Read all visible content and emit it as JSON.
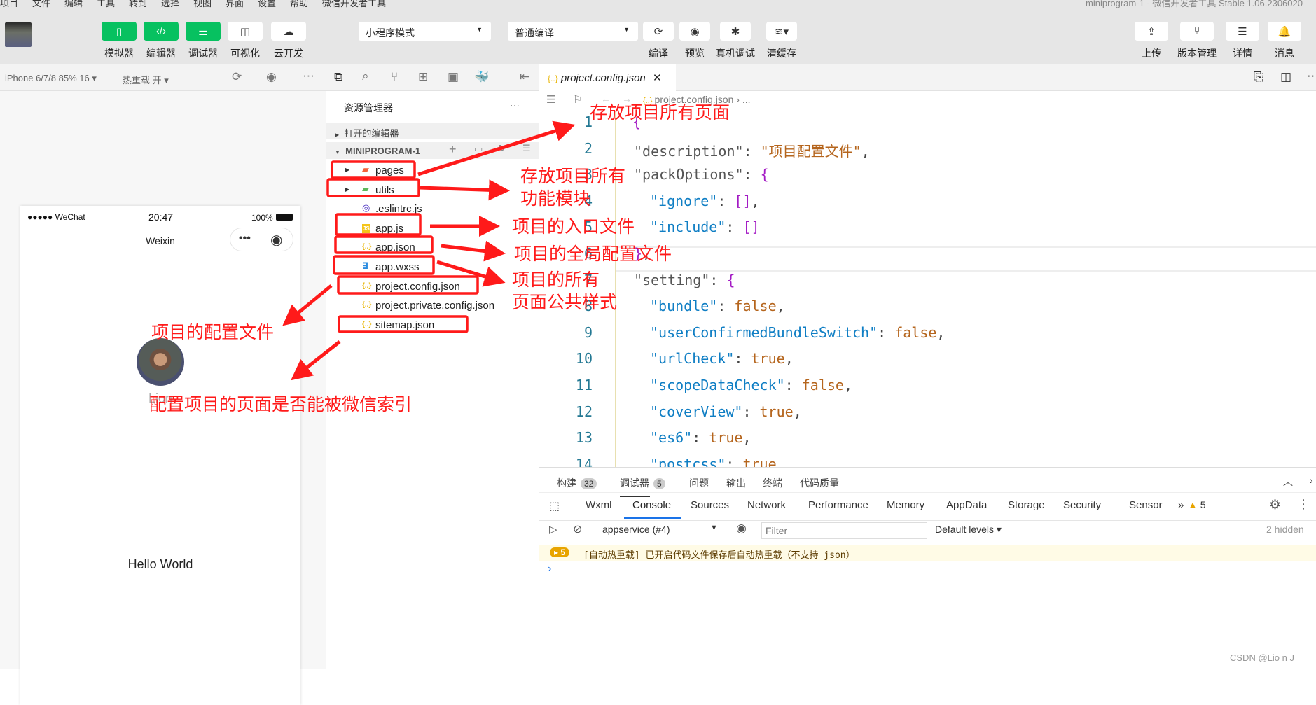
{
  "menubar": {
    "items": [
      "项目",
      "文件",
      "编辑",
      "工具",
      "转到",
      "选择",
      "视图",
      "界面",
      "设置",
      "帮助",
      "微信开发者工具"
    ],
    "title": "miniprogram-1 - 微信开发者工具 Stable 1.06.2306020"
  },
  "toolbar": {
    "left_buttons": [
      {
        "label": "模拟器",
        "icon": "phone-icon"
      },
      {
        "label": "编辑器",
        "icon": "code-icon"
      },
      {
        "label": "调试器",
        "icon": "sliders-icon"
      },
      {
        "label": "可视化",
        "icon": "layout-icon"
      },
      {
        "label": "云开发",
        "icon": "cloud-icon"
      }
    ],
    "mode_select": "小程序模式",
    "compile_select": "普通编译",
    "mid_buttons": [
      {
        "label": "编译",
        "icon": "refresh-icon"
      },
      {
        "label": "预览",
        "icon": "eye-icon"
      },
      {
        "label": "真机调试",
        "icon": "bug-icon"
      },
      {
        "label": "清缓存",
        "icon": "layers-icon"
      }
    ],
    "right_buttons": [
      {
        "label": "上传",
        "icon": "upload-icon"
      },
      {
        "label": "版本管理",
        "icon": "branch-icon"
      },
      {
        "label": "详情",
        "icon": "menu-icon"
      },
      {
        "label": "消息",
        "icon": "bell-icon"
      }
    ]
  },
  "simbar": {
    "device": "iPhone 6/7/8 85% 16 ▾",
    "hot_reload": "热重载 开 ▾"
  },
  "phone": {
    "carrier": "●●●●● WeChat",
    "time": "20:47",
    "battery": "100%",
    "nav_title": "Weixin",
    "username": "Lion",
    "hello": "Hello World"
  },
  "explorer": {
    "title": "资源管理器",
    "more": "···",
    "open_editors": "打开的编辑器",
    "project": "MINIPROGRAM-1",
    "files": [
      {
        "name": "pages",
        "icon": "folder-icon",
        "folder": true,
        "color": "#f4623a"
      },
      {
        "name": "utils",
        "icon": "folder-icon",
        "folder": true,
        "color": "#5cb85c"
      },
      {
        "name": ".eslintrc.js",
        "icon": "eslint-icon",
        "color": "#4b32c3"
      },
      {
        "name": "app.js",
        "icon": "js-icon",
        "color": "#f5c518"
      },
      {
        "name": "app.json",
        "icon": "json-icon",
        "color": "#e8b400"
      },
      {
        "name": "app.wxss",
        "icon": "css-icon",
        "color": "#2a8be0"
      },
      {
        "name": "project.config.json",
        "icon": "json-icon",
        "color": "#e8b400"
      },
      {
        "name": "project.private.config.json",
        "icon": "json-icon",
        "color": "#e8b400"
      },
      {
        "name": "sitemap.json",
        "icon": "json-icon",
        "color": "#e8b400"
      }
    ]
  },
  "editor": {
    "tab": "project.config.json",
    "breadcrumb": "project.config.json  ›  ...",
    "lines": [
      {
        "n": "1",
        "indent": 0,
        "tokens": [
          [
            "{",
            "p"
          ]
        ]
      },
      {
        "n": "2",
        "indent": 1,
        "tokens": [
          [
            "\"description\"",
            "k1"
          ],
          [
            ": ",
            "o"
          ],
          [
            "\"项目配置文件\"",
            "s"
          ],
          [
            ",",
            "o"
          ]
        ]
      },
      {
        "n": "3",
        "indent": 1,
        "tokens": [
          [
            "\"packOptions\"",
            "k1"
          ],
          [
            ": ",
            "o"
          ],
          [
            "{",
            "p"
          ]
        ]
      },
      {
        "n": "4",
        "indent": 2,
        "tokens": [
          [
            "\"ignore\"",
            "k2"
          ],
          [
            ": ",
            "o"
          ],
          [
            "[]",
            "p"
          ],
          [
            ",",
            "o"
          ]
        ]
      },
      {
        "n": "5",
        "indent": 2,
        "tokens": [
          [
            "\"include\"",
            "k2"
          ],
          [
            ": ",
            "o"
          ],
          [
            "[]",
            "p"
          ]
        ]
      },
      {
        "n": "6",
        "indent": 1,
        "tokens": [
          [
            "}",
            "p"
          ],
          [
            ",",
            "o"
          ]
        ]
      },
      {
        "n": "7",
        "indent": 1,
        "tokens": [
          [
            "\"setting\"",
            "k1"
          ],
          [
            ": ",
            "o"
          ],
          [
            "{",
            "p"
          ]
        ]
      },
      {
        "n": "8",
        "indent": 2,
        "tokens": [
          [
            "\"bundle\"",
            "k2"
          ],
          [
            ": ",
            "o"
          ],
          [
            "false",
            "b"
          ],
          [
            ",",
            "o"
          ]
        ]
      },
      {
        "n": "9",
        "indent": 2,
        "tokens": [
          [
            "\"userConfirmedBundleSwitch\"",
            "k2"
          ],
          [
            ": ",
            "o"
          ],
          [
            "false",
            "b"
          ],
          [
            ",",
            "o"
          ]
        ]
      },
      {
        "n": "10",
        "indent": 2,
        "tokens": [
          [
            "\"urlCheck\"",
            "k2"
          ],
          [
            ": ",
            "o"
          ],
          [
            "true",
            "b"
          ],
          [
            ",",
            "o"
          ]
        ]
      },
      {
        "n": "11",
        "indent": 2,
        "tokens": [
          [
            "\"scopeDataCheck\"",
            "k2"
          ],
          [
            ": ",
            "o"
          ],
          [
            "false",
            "b"
          ],
          [
            ",",
            "o"
          ]
        ]
      },
      {
        "n": "12",
        "indent": 2,
        "tokens": [
          [
            "\"coverView\"",
            "k2"
          ],
          [
            ": ",
            "o"
          ],
          [
            "true",
            "b"
          ],
          [
            ",",
            "o"
          ]
        ]
      },
      {
        "n": "13",
        "indent": 2,
        "tokens": [
          [
            "\"es6\"",
            "k2"
          ],
          [
            ": ",
            "o"
          ],
          [
            "true",
            "b"
          ],
          [
            ",",
            "o"
          ]
        ]
      },
      {
        "n": "14",
        "indent": 2,
        "tokens": [
          [
            "\"postcss\"",
            "k2"
          ],
          [
            ": ",
            "o"
          ],
          [
            "true",
            "b"
          ]
        ]
      }
    ]
  },
  "panel": {
    "tabs": [
      {
        "label": "构建",
        "badge": "32"
      },
      {
        "label": "调试器",
        "badge": "5",
        "active": true
      },
      {
        "label": "问题"
      },
      {
        "label": "输出"
      },
      {
        "label": "终端"
      },
      {
        "label": "代码质量"
      }
    ],
    "devtools_tabs": [
      "Wxml",
      "Console",
      "Sources",
      "Network",
      "Performance",
      "Memory",
      "AppData",
      "Storage",
      "Security",
      "Sensor"
    ],
    "active_devtool": "Console",
    "more": "»",
    "warnings": "5",
    "context": "appservice (#4)",
    "filter_placeholder": "Filter",
    "levels": "Default levels ▾",
    "hidden": "2 hidden",
    "message_badge": "5",
    "message": "[自动热重载] 已开启代码文件保存后自动热重载（不支持 json）",
    "prompt": "›"
  },
  "annotations": {
    "pages": "存放项目所有页面",
    "utils_1": "存放项目所有",
    "utils_2": "功能模块",
    "app_js": "项目的入口文件",
    "app_json": "项目的全局配置文件",
    "app_wxss_1": "项目的所有",
    "app_wxss_2": "页面公共样式",
    "project_config": "项目的配置文件",
    "sitemap": "配置项目的页面是否能被微信索引"
  },
  "watermark": "CSDN @Lio n J"
}
